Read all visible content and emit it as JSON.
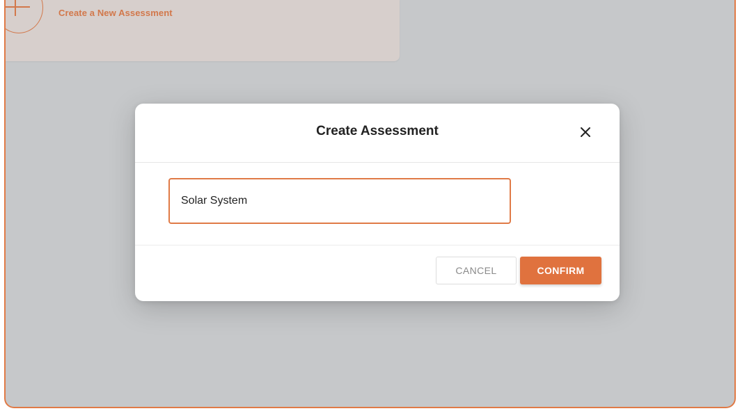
{
  "background_card": {
    "title": "Create a New Assessment",
    "icon": "plus-circle-icon"
  },
  "modal": {
    "title": "Create Assessment",
    "close_icon": "close-icon",
    "input": {
      "value": "Solar System",
      "placeholder": ""
    },
    "cancel_label": "CANCEL",
    "confirm_label": "CONFIRM"
  },
  "colors": {
    "accent": "#e0723e",
    "backdrop": "#c6c8ca",
    "card": "#d7cfcc"
  }
}
